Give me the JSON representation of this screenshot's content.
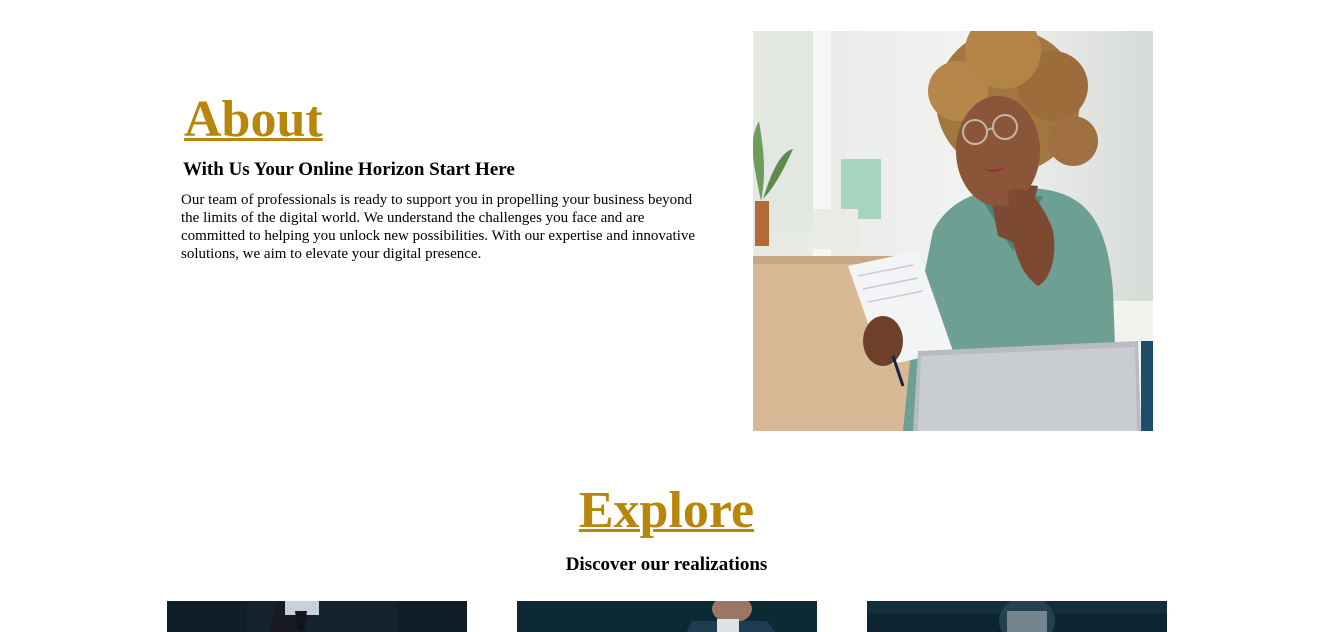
{
  "about": {
    "title": "About",
    "subtitle": "With Us Your Online Horizon Start Here",
    "body": "Our team of professionals is ready to support you in propelling your business beyond the limits of the digital world. We understand the challenges you face and are committed to helping you unlock new possibilities. With our expertise and innovative solutions, we aim to elevate your digital presence."
  },
  "explore": {
    "title": "Explore",
    "subtitle": "Discover our realizations"
  },
  "colors": {
    "heading_accent": "#b8860b",
    "text": "#000000",
    "background": "#ffffff"
  }
}
